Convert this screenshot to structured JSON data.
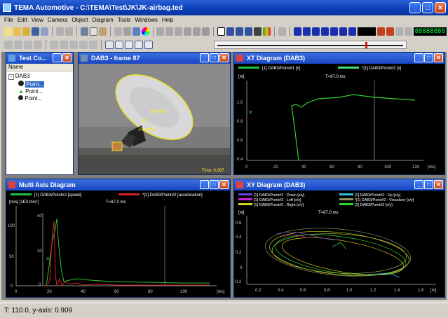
{
  "window": {
    "title": "TEMA Automotive - C:\\TEMA\\Test\\JK\\JK-airbag.ted"
  },
  "menu": [
    "File",
    "Edit",
    "View",
    "Camera",
    "Object",
    "Diagram",
    "Tools",
    "Windows",
    "Help"
  ],
  "toolbar": {
    "frame_display": "88888888"
  },
  "test_panel": {
    "title": "Test Co...",
    "column": "Name",
    "tree": {
      "root": "DAB3",
      "items": [
        "Point...",
        "Point...",
        "Point..."
      ]
    }
  },
  "image_panel": {
    "title": "DAB3 - frame 87",
    "point2": "Point#2",
    "point3": "Point#3",
    "time": "Time: 0.087"
  },
  "xt_panel": {
    "title": "XT Diagram (DAB3)",
    "legend": [
      "[1] DAB3/Point#1 [x]",
      "*[1] DAB3/Point#2 [x]"
    ],
    "unit_y": "[m]",
    "unit_x": "[ms]",
    "time": "T=87.0 ms",
    "y_ticks": [
      "1.0",
      "0.8",
      "0.6",
      "0.4"
    ],
    "x_ticks": [
      "0",
      "20",
      "40",
      "60",
      "80",
      "100",
      "120"
    ]
  },
  "multi_panel": {
    "title": "Multi Axis Diagram",
    "legend": [
      "[1] DAB3/Point#2 [speed]",
      "*[2] DAB3/Point#2 [acceleration]"
    ],
    "unit_y": "[m/s] [1E3 m/s²]",
    "unit_x": "[ms]",
    "time": "T=87.0 ms",
    "y_ticks_left": [
      "100",
      "50",
      "0"
    ],
    "y_ticks_inner": [
      "40",
      "20",
      "0"
    ],
    "x_ticks": [
      "0",
      "20",
      "40",
      "60",
      "80",
      "100"
    ]
  },
  "xy_panel": {
    "title": "XY Diagram (DAB3)",
    "legend": [
      "[1] DAB3/Point#2 : Down [x/y]",
      "[1] DAB3/Point#2 : Left [x/y]",
      "[1] DAB3/Point#2 : Right [x/y]",
      "[1] DAB3/Point#2 : Up [x/y]",
      "*[1] DAB3/Point#2 : Visualizer [x/y]",
      "[1] DAB3/Point#2 [x/y]"
    ],
    "unit_y": "[m]",
    "unit_x": "[m]",
    "time": "T=87.0 ms",
    "y_ticks": [
      "0.6",
      "0.4",
      "0.2",
      "0",
      "-0.2"
    ],
    "x_ticks": [
      "0.2",
      "0.4",
      "0.6",
      "0.8",
      "1.0",
      "1.2",
      "1.4",
      "1.6"
    ]
  },
  "status": {
    "text": "T: 110.0, y-axis: 0.909"
  }
}
